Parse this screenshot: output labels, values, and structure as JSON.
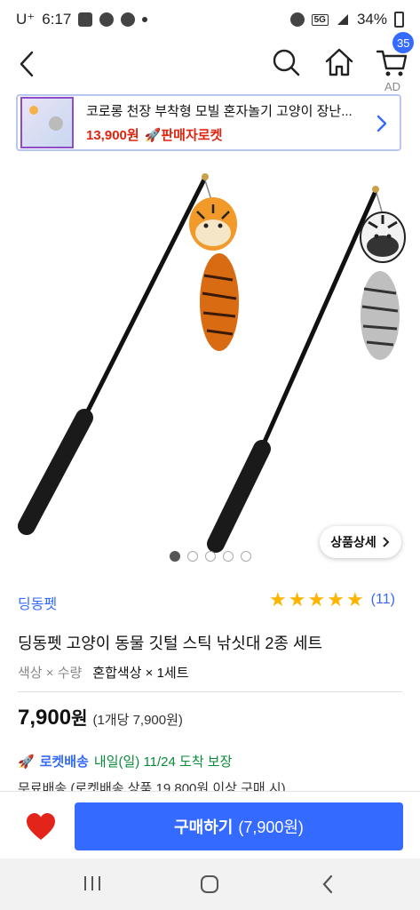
{
  "status_bar": {
    "carrier": "U⁺",
    "time": "6:17",
    "network": "5G",
    "battery": "34%"
  },
  "nav": {
    "cart_count": "35"
  },
  "ad": {
    "label": "AD",
    "title": "코로롱 천장 부착형 모빌 혼자놀기 고양이 장난...",
    "price": "13,900원",
    "delivery_badge": "🚀판매자로켓"
  },
  "gallery": {
    "detail_button": "상품상세",
    "active_index": 0,
    "count": 5
  },
  "product": {
    "brand": "딩동펫",
    "rating": 5,
    "review_count": "(11)",
    "title": "딩동펫 고양이 동물 깃털 스틱 낚싯대 2종 세트",
    "option_label": "색상 × 수량",
    "option_value": "혼합색상 × 1세트",
    "price": "7,900",
    "price_currency": "원",
    "unit_price": "(1개당 7,900원)",
    "delivery_icon": "🚀",
    "delivery_type": "로켓배송",
    "delivery_date": "내일(일) 11/24 도착 보장",
    "free_shipping": "무료배송 (로켓배송 상품 19,800원 이상 구매 시)"
  },
  "buy_bar": {
    "button_label": "구매하기",
    "button_price": "(7,900원)"
  },
  "colors": {
    "accent": "#346aff",
    "price_red": "#e0230e",
    "star": "#ffb400",
    "delivery_green": "#0a8a3a"
  }
}
